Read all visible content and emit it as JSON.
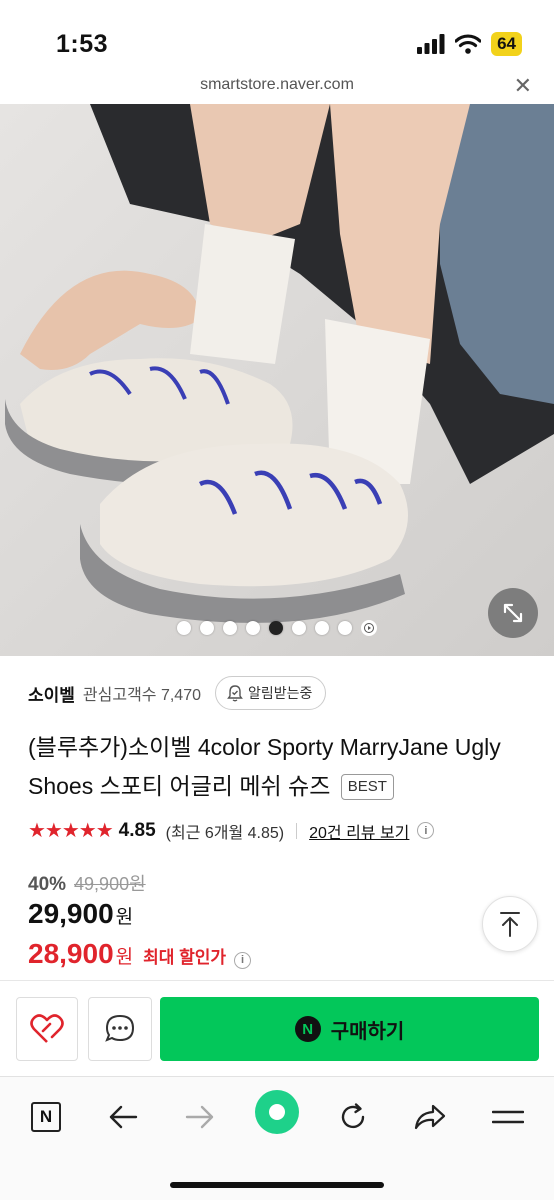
{
  "status_bar": {
    "time": "1:53",
    "battery": "64"
  },
  "url_bar": {
    "domain": "smartstore.naver.com",
    "close": "✕"
  },
  "gallery": {
    "total_images": 8,
    "active_index": 4
  },
  "store": {
    "name": "소이벨",
    "followers": "관심고객수 7,470",
    "notify_label": "알림받는중"
  },
  "product": {
    "title": "(블루추가)소이벨 4color Sporty MarryJane Ugly Shoes 스포티 어글리 메쉬 슈즈",
    "badge": "BEST"
  },
  "rating": {
    "stars": "★★★★★",
    "value": "4.85",
    "recent": "(최근 6개월 4.85)",
    "review_link": "20건 리뷰 보기",
    "info": "i"
  },
  "price": {
    "discount": "40%",
    "original": "49,900원",
    "sale": "29,900",
    "sale_unit": "원",
    "max_discount": "28,900",
    "max_unit": "원",
    "max_label": "최대 할인가",
    "info": "i"
  },
  "actions": {
    "buy_label": "구매하기",
    "npay": "N"
  },
  "toolbar": {
    "n_label": "N"
  },
  "colors": {
    "accent_green": "#03c75a",
    "price_red": "#e0242c",
    "badge_yellow": "#f2d21b"
  }
}
